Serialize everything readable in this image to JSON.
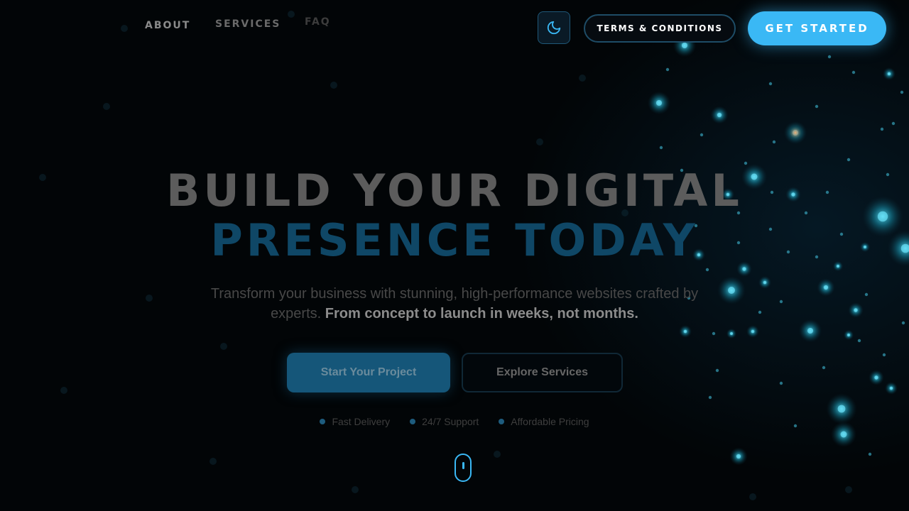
{
  "nav": {
    "links": [
      {
        "label": "ABOUT"
      },
      {
        "label": "SERVICES"
      },
      {
        "label": "FAQ"
      }
    ],
    "theme_toggle_icon": "moon-icon",
    "terms_label": "TERMS & CONDITIONS",
    "cta_label": "GET STARTED"
  },
  "hero": {
    "title_line1": "BUILD YOUR DIGITAL",
    "title_line2": "PRESENCE TODAY",
    "description": "Transform your business with stunning, high-performance websites crafted by experts.",
    "description_highlight": "From concept to launch in weeks, not months.",
    "primary_cta": "Start Your Project",
    "secondary_cta": "Explore Services",
    "features": [
      {
        "label": "Fast Delivery"
      },
      {
        "label": "24/7 Support"
      },
      {
        "label": "Affordable Pricing"
      }
    ],
    "scroll_icon": "mouse-scroll-icon"
  },
  "colors": {
    "accent": "#3ab8f5",
    "background": "#020507",
    "title_primary": "#5c5c5c",
    "title_accent": "#0f4766",
    "particle": "#4fd8f0"
  }
}
